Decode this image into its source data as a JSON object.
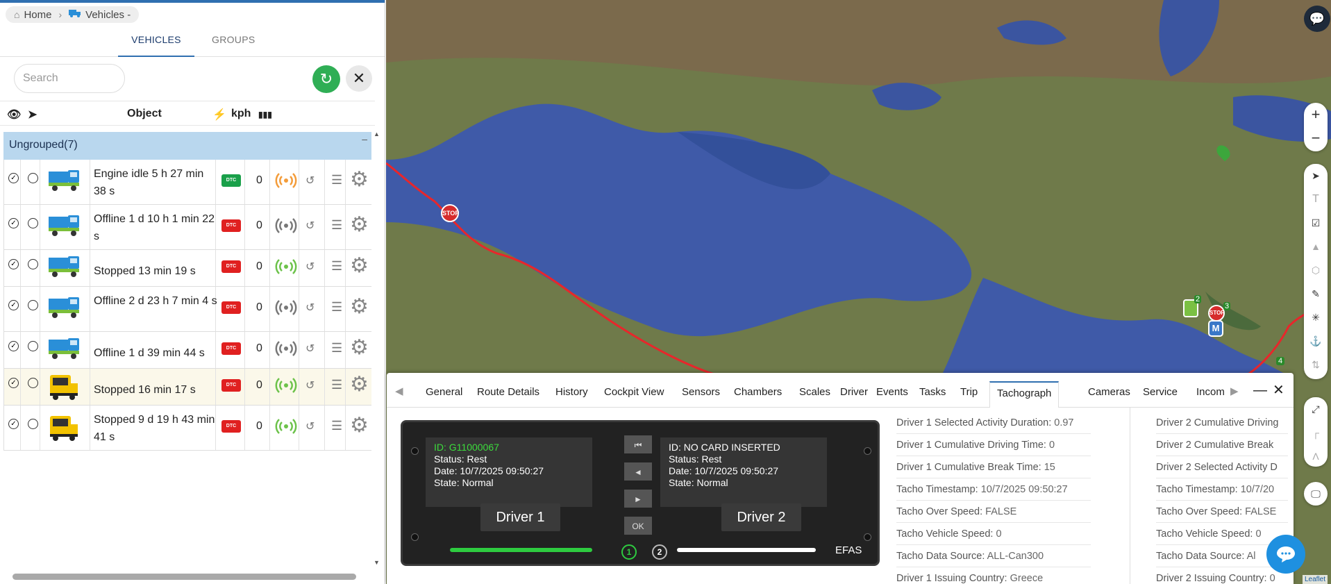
{
  "breadcrumb": {
    "home": "Home",
    "current": "Vehicles -"
  },
  "left_tabs": [
    "VEHICLES",
    "GROUPS"
  ],
  "search": {
    "placeholder": "Search"
  },
  "table_header": {
    "object": "Object",
    "speed_unit": "kph"
  },
  "group": {
    "label": "Ungrouped(7)",
    "collapse": "–"
  },
  "vehicles": [
    {
      "status": "Engine idle 5 h 27 min 38 s",
      "speed": "0",
      "icon": "small-truck-blue",
      "engine": "DTC",
      "engine_color": "#1aa04a",
      "signal_color": "#f39c3a",
      "highlight": false
    },
    {
      "status": "Offline 1 d 10 h 1 min 22 s",
      "speed": "0",
      "icon": "small-truck-blue",
      "engine": "DTC",
      "engine_color": "#e02020",
      "signal_color": "#777777",
      "highlight": false
    },
    {
      "status": "Stopped 13 min 19 s",
      "speed": "0",
      "icon": "small-truck-blue",
      "engine": "DTC",
      "engine_color": "#e02020",
      "signal_color": "#6cc24a",
      "highlight": false
    },
    {
      "status": "Offline 2 d 23 h 7 min 4 s",
      "speed": "0",
      "icon": "small-truck-blue",
      "engine": "DTC",
      "engine_color": "#e02020",
      "signal_color": "#777777",
      "highlight": false
    },
    {
      "status": "Offline 1 d 39 min 44 s",
      "speed": "0",
      "icon": "small-truck-blue",
      "engine": "DTC",
      "engine_color": "#e02020",
      "signal_color": "#777777",
      "highlight": false
    },
    {
      "status": "Stopped 16 min 17 s",
      "speed": "0",
      "icon": "yellow-semi-truck",
      "engine": "DTC",
      "engine_color": "#e02020",
      "signal_color": "#6cc24a",
      "highlight": true
    },
    {
      "status": "Stopped 9 d 19 h 43 min 41 s",
      "speed": "0",
      "icon": "yellow-semi-truck",
      "engine": "DTC",
      "engine_color": "#e02020",
      "signal_color": "#6cc24a",
      "highlight": false
    }
  ],
  "panel_tabs": [
    "General",
    "Route Details",
    "History",
    "Cockpit View",
    "Sensors",
    "Chambers",
    "Scales",
    "Driver",
    "Events",
    "Tasks",
    "Trip",
    "Tachograph",
    "Cameras",
    "Service",
    "Incom"
  ],
  "active_panel_tab": "Tachograph",
  "tachograph": {
    "driver1": {
      "id": "ID: G11000067",
      "status": "Status: Rest",
      "date": "Date: 10/7/2025 09:50:27",
      "state": "State: Normal",
      "label": "Driver 1"
    },
    "driver2": {
      "id": "ID: NO CARD INSERTED",
      "status": "Status: Rest",
      "date": "Date: 10/7/2025 09:50:27",
      "state": "State: Normal",
      "label": "Driver 2"
    },
    "controls": [
      "⏮",
      "◄",
      "►",
      "OK"
    ],
    "slot1": "1",
    "slot2": "2",
    "efas": "EFAS"
  },
  "info_col1": [
    {
      "k": "Driver 1 Selected Activity Duration:",
      "v": "0.97"
    },
    {
      "k": "Driver 1 Cumulative Driving Time:",
      "v": "0"
    },
    {
      "k": "Driver 1 Cumulative Break Time:",
      "v": "15"
    },
    {
      "k": "Tacho Timestamp:",
      "v": "10/7/2025 09:50:27"
    },
    {
      "k": "Tacho Over Speed:",
      "v": "FALSE"
    },
    {
      "k": "Tacho Vehicle Speed:",
      "v": "0"
    },
    {
      "k": "Tacho Data Source:",
      "v": "ALL-Can300"
    },
    {
      "k": "Driver 1 Issuing Country:",
      "v": "Greece"
    }
  ],
  "info_col2": [
    {
      "k": "Driver 2 Cumulative Driving",
      "v": ""
    },
    {
      "k": "Driver 2 Cumulative Break",
      "v": ""
    },
    {
      "k": "Driver 2 Selected Activity D",
      "v": ""
    },
    {
      "k": "Tacho Timestamp:",
      "v": "10/7/20"
    },
    {
      "k": "Tacho Over Speed:",
      "v": "FALSE"
    },
    {
      "k": "Tacho Vehicle Speed:",
      "v": "0"
    },
    {
      "k": "Tacho Data Source:",
      "v": "Al"
    },
    {
      "k": "Driver 2 Issuing Country:",
      "v": "0"
    }
  ],
  "map": {
    "attribution": "Leaflet",
    "zoom_in": "+",
    "zoom_out": "−",
    "stop": "STOP",
    "marker_m": "M",
    "cluster_2": "2",
    "cluster_3": "3",
    "marker_4": "4"
  },
  "colors": {
    "accent": "#2f6fb0",
    "green": "#2fae55",
    "route": "#e8262b"
  }
}
